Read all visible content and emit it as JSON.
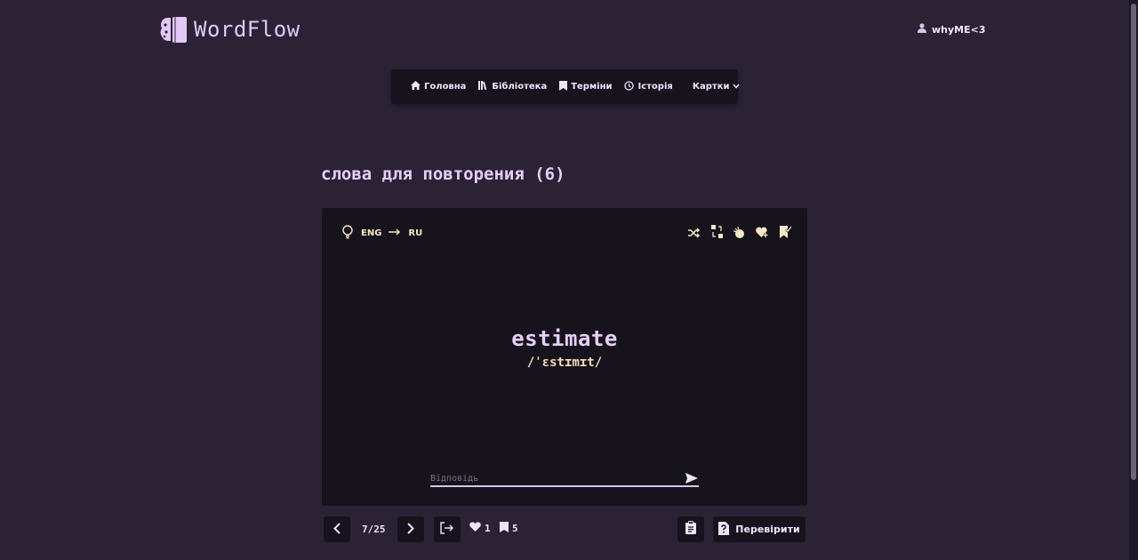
{
  "app": {
    "name": "WordFlow"
  },
  "user": {
    "name": "whyME<3"
  },
  "nav": {
    "items": [
      {
        "label": "Головна",
        "icon": "home-icon"
      },
      {
        "label": "Бібліотека",
        "icon": "library-icon"
      },
      {
        "label": "Терміни",
        "icon": "bookmark-icon"
      },
      {
        "label": "Історія",
        "icon": "history-icon"
      }
    ],
    "dropdown": {
      "label": "Картки",
      "icon": "chevron-down-icon"
    }
  },
  "page": {
    "title": "слова для повторения (6)"
  },
  "card": {
    "hint_icon": "lightbulb-icon",
    "source_lang": "ENG",
    "target_lang": "RU",
    "actions": [
      "shuffle-icon",
      "swap-icon",
      "finger-snap-icon",
      "heart-add-icon",
      "bookmark-check-icon"
    ],
    "word": "estimate",
    "transcription": "/ˈɛstɪmɪt/",
    "answer": {
      "value": "",
      "placeholder": "Відповідь"
    }
  },
  "controls": {
    "position": "7/25",
    "likes": "1",
    "saved": "5",
    "check_label": "Перевірити"
  },
  "colors": {
    "background": "#2b2236",
    "panel": "#17131c",
    "accent": "#e6cef9",
    "secondary": "#f5ddb8"
  }
}
